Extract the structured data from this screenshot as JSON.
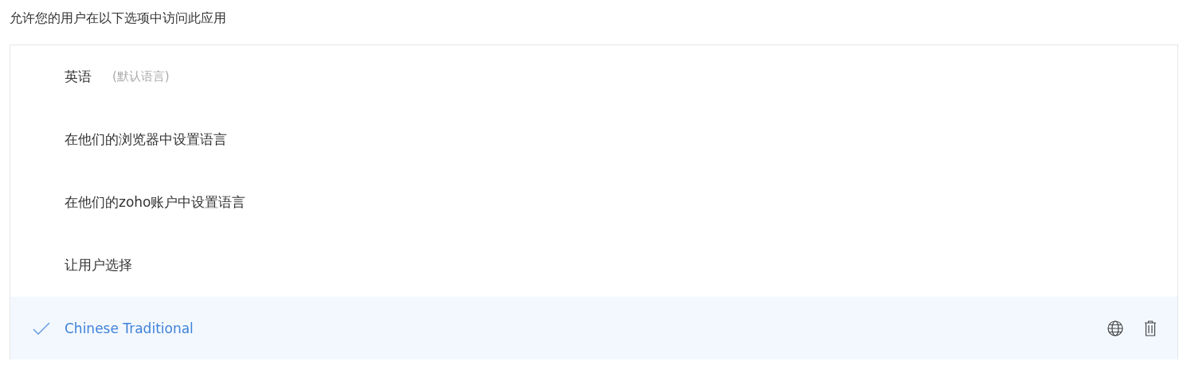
{
  "heading": "允许您的用户在以下选项中访问此应用",
  "options": [
    {
      "label": "英语",
      "note": "(默认语言)",
      "selected": false,
      "actions": false
    },
    {
      "label": "在他们的浏览器中设置语言",
      "selected": false,
      "actions": false
    },
    {
      "label": "在他们的zoho账户中设置语言",
      "selected": false,
      "actions": false
    },
    {
      "label": "让用户选择",
      "selected": false,
      "actions": false
    },
    {
      "label": "Chinese Traditional",
      "selected": true,
      "actions": true
    }
  ]
}
